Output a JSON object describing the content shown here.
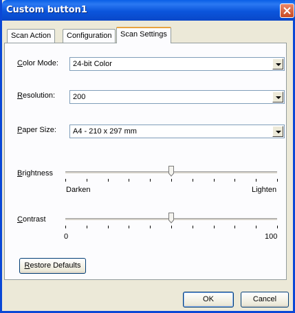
{
  "window": {
    "title": "Custom button1"
  },
  "tabs": [
    {
      "label": "Scan Action",
      "active": false
    },
    {
      "label": "Configuration",
      "active": false
    },
    {
      "label": "Scan Settings",
      "active": true
    }
  ],
  "color_mode": {
    "label_first": "C",
    "label_rest": "olor Mode:",
    "value": "24-bit Color"
  },
  "resolution": {
    "label_first": "R",
    "label_rest": "esolution:",
    "value": "200"
  },
  "paper_size": {
    "label_first": "P",
    "label_rest": "aper Size:",
    "value": "A4 - 210 x 297 mm"
  },
  "brightness": {
    "label_first": "B",
    "label_rest": "rightness",
    "min_label": "Darken",
    "max_label": "Lighten",
    "level": 0.5
  },
  "contrast": {
    "label_first": "C",
    "label_rest": "ontrast",
    "min_label": "0",
    "max_label": "100",
    "level": 0.5
  },
  "restore_button": {
    "label_first": "R",
    "label_rest": "estore Defaults"
  },
  "footer": {
    "ok_label": "OK",
    "cancel_label": "Cancel"
  },
  "icons": {
    "close": "close-icon",
    "dropdown": "chevron-down-icon"
  },
  "colors": {
    "title_bar": "#0a5fe6",
    "close_button": "#c94a21",
    "active_tab_accent": "#e8a33d"
  }
}
